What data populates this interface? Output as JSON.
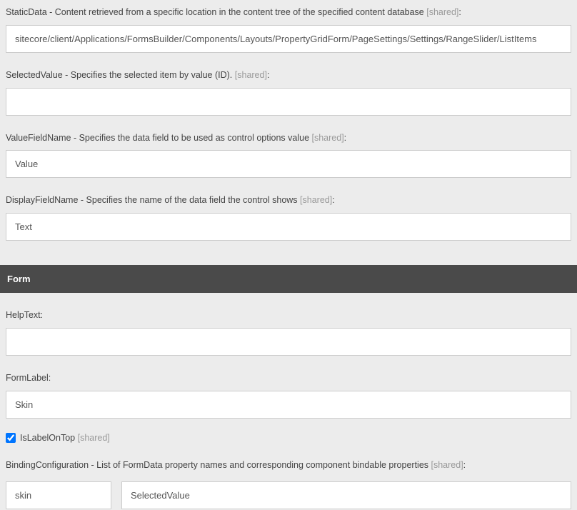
{
  "fields": {
    "staticData": {
      "labelName": "StaticData",
      "labelDesc": " - Content retrieved from a specific location in the content tree of the specified content database ",
      "shared": "[shared]",
      "colon": ":",
      "value": "sitecore/client/Applications/FormsBuilder/Components/Layouts/PropertyGridForm/PageSettings/Settings/RangeSlider/ListItems"
    },
    "selectedValue": {
      "labelName": "SelectedValue",
      "labelDesc": " - Specifies the selected item by value (ID). ",
      "shared": "[shared]",
      "colon": ":",
      "value": ""
    },
    "valueFieldName": {
      "labelName": "ValueFieldName",
      "labelDesc": " - Specifies the data field to be used as control options value ",
      "shared": "[shared]",
      "colon": ":",
      "value": "Value"
    },
    "displayFieldName": {
      "labelName": "DisplayFieldName",
      "labelDesc": " - Specifies the name of the data field the control shows ",
      "shared": "[shared]",
      "colon": ":",
      "value": "Text"
    }
  },
  "section": {
    "form": "Form"
  },
  "formFields": {
    "helpText": {
      "label": "HelpText:",
      "value": ""
    },
    "formLabel": {
      "label": "FormLabel:",
      "value": "Skin"
    },
    "isLabelOnTop": {
      "label": "IsLabelOnTop ",
      "shared": "[shared]",
      "checked": true
    },
    "bindingConfiguration": {
      "labelName": "BindingConfiguration",
      "labelDesc": " - List of FormData property names and corresponding component bindable properties ",
      "shared": "[shared]",
      "colon": ":",
      "key": "skin",
      "val": "SelectedValue"
    }
  }
}
